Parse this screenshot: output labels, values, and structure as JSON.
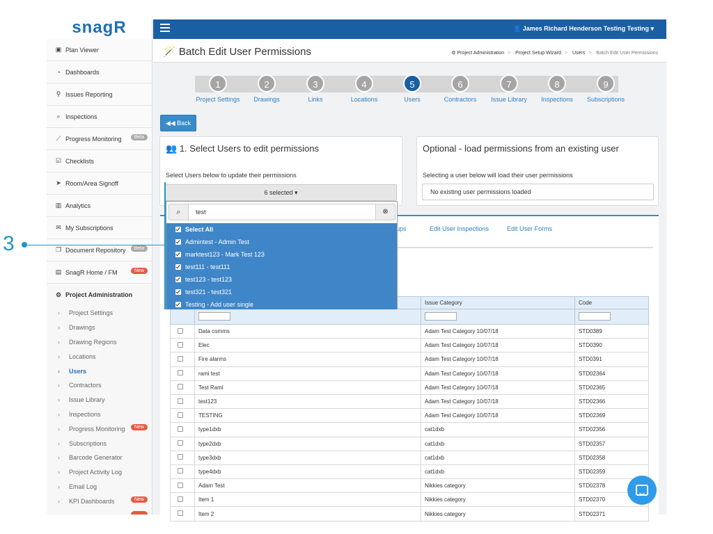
{
  "app": {
    "logo": "snagR"
  },
  "sidebar": {
    "items": [
      {
        "icon": "image-icon",
        "glyph": "▣",
        "label": "Plan Viewer"
      },
      {
        "icon": "dashboard-icon",
        "glyph": "◔",
        "label": "Dashboards"
      },
      {
        "icon": "map-pin-icon",
        "glyph": "⚲",
        "label": "Issues Reporting"
      },
      {
        "icon": "search-icon",
        "glyph": "⌕",
        "label": "Inspections"
      },
      {
        "icon": "line-chart-icon",
        "glyph": "⟋",
        "label": "Progress Monitoring",
        "badge": "Beta"
      },
      {
        "icon": "checklist-icon",
        "glyph": "☑",
        "label": "Checklists"
      },
      {
        "icon": "location-arrow-icon",
        "glyph": "➤",
        "label": "Room/Area Signoff"
      },
      {
        "icon": "bar-chart-icon",
        "glyph": "▥",
        "label": "Analytics"
      },
      {
        "icon": "envelope-icon",
        "glyph": "✉",
        "label": "My Subscriptions"
      },
      {
        "icon": "document-icon",
        "glyph": "❐",
        "label": "Document Repository",
        "badge": "Beta"
      },
      {
        "icon": "building-icon",
        "glyph": "▤",
        "label": "SnagR Home / FM",
        "badge": "New"
      },
      {
        "icon": "cogs-icon",
        "glyph": "⚙",
        "label": "Project Administration"
      }
    ],
    "sub_items": [
      {
        "label": "Project Settings"
      },
      {
        "label": "Drawings"
      },
      {
        "label": "Drawing Regions"
      },
      {
        "label": "Locations"
      },
      {
        "label": "Users",
        "active": true
      },
      {
        "label": "Contractors"
      },
      {
        "label": "Issue Library"
      },
      {
        "label": "Inspections"
      },
      {
        "label": "Progress Monitoring",
        "badge": "New"
      },
      {
        "label": "Subscriptions"
      },
      {
        "label": "Barcode Generator"
      },
      {
        "label": "Project Activity Log"
      },
      {
        "label": "Email Log"
      },
      {
        "label": "KPI Dashboards",
        "badge": "New"
      },
      {
        "label": "",
        "badge": ""
      }
    ]
  },
  "topbar": {
    "user": "James Richard Henderson Testing Testing ▾"
  },
  "header": {
    "title": "Batch Edit User Permissions",
    "breadcrumbs": [
      "Project Administration",
      "Project Setup Wizard",
      "Users",
      "Batch Edit User Permissions"
    ]
  },
  "wizard": {
    "steps": [
      {
        "num": "1",
        "label": "Project Settings"
      },
      {
        "num": "2",
        "label": "Drawings"
      },
      {
        "num": "3",
        "label": "Links"
      },
      {
        "num": "4",
        "label": "Locations"
      },
      {
        "num": "5",
        "label": "Users",
        "active": true
      },
      {
        "num": "6",
        "label": "Contractors"
      },
      {
        "num": "7",
        "label": "Issue Library"
      },
      {
        "num": "8",
        "label": "Inspections"
      },
      {
        "num": "9",
        "label": "Subscriptions"
      }
    ]
  },
  "back_button": {
    "label": "Back"
  },
  "select_users": {
    "title": "1. Select Users to edit permissions",
    "help": "Select Users below to update their permissions",
    "button_label": "6 selected ▾",
    "search_value": "test",
    "options": [
      {
        "label": "Select All",
        "bold": true
      },
      {
        "label": "Admintest - Admin Test"
      },
      {
        "label": "marktest123 - Mark Test 123"
      },
      {
        "label": "test111 - test111"
      },
      {
        "label": "test123 - test123"
      },
      {
        "label": "test321 - test321"
      },
      {
        "label": "Testing - Add user single"
      }
    ]
  },
  "optional": {
    "title": "Optional - load permissions from an existing user",
    "help": "Selecting a user below will load their user permissions",
    "value": "No existing user permissions loaded"
  },
  "tabs": [
    {
      "label": "oups"
    },
    {
      "label": "Edit User Inspections"
    },
    {
      "label": "Edit User Forms"
    }
  ],
  "table": {
    "headers": [
      "",
      "",
      "Issue Category",
      "Code"
    ],
    "rows": [
      {
        "name": "Data comms",
        "category": "Adam Test Category 10/07/18",
        "code": "STD0389"
      },
      {
        "name": "Elec",
        "category": "Adam Test Category 10/07/18",
        "code": "STD0390"
      },
      {
        "name": "Fire alarms",
        "category": "Adam Test Category 10/07/18",
        "code": "STD0391"
      },
      {
        "name": "rami test",
        "category": "Adam Test Category 10/07/18",
        "code": "STD02364"
      },
      {
        "name": "Test Rami",
        "category": "Adam Test Category 10/07/18",
        "code": "STD02365"
      },
      {
        "name": "test123",
        "category": "Adam Test Category 10/07/18",
        "code": "STD02366"
      },
      {
        "name": "TESTING",
        "category": "Adam Test Category 10/07/18",
        "code": "STD02369"
      },
      {
        "name": "type1dxb",
        "category": "cat1dxb",
        "code": "STD02356"
      },
      {
        "name": "type2dxb",
        "category": "cat1dxb",
        "code": "STD02357"
      },
      {
        "name": "type3dxb",
        "category": "cat1dxb",
        "code": "STD02358"
      },
      {
        "name": "type4dxb",
        "category": "cat1dxb",
        "code": "STD02359"
      },
      {
        "name": "Adam Test",
        "category": "Nikkies category",
        "code": "STD02378"
      },
      {
        "name": "Item 1",
        "category": "Nikkies category",
        "code": "STD02370"
      },
      {
        "name": "Item 2",
        "category": "Nikkies category",
        "code": "STD02371"
      }
    ]
  },
  "annotation": {
    "number": "3"
  },
  "colors": {
    "brand": "#1a5fa3",
    "accent": "#3a8cc9",
    "selection": "#3f86c8",
    "annotation": "#1e96c8",
    "badge_new": "#e55a45"
  }
}
